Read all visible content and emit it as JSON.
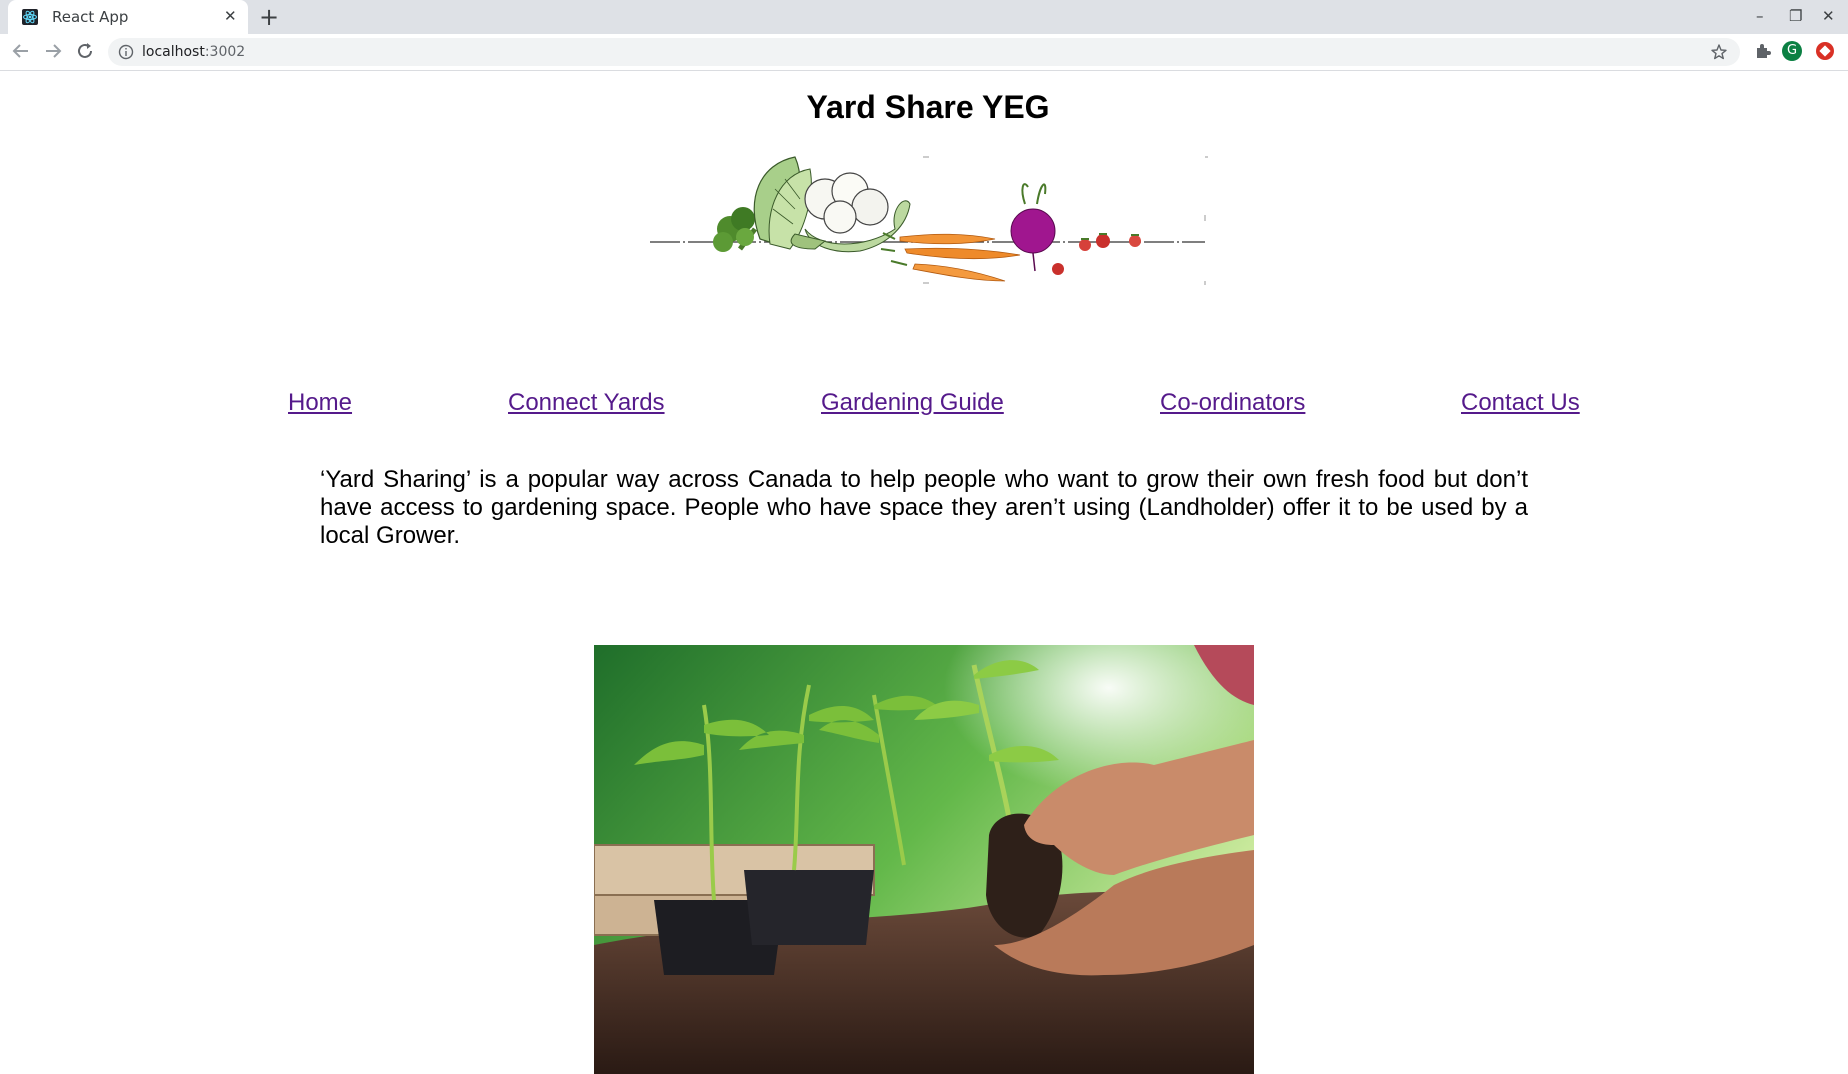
{
  "browser": {
    "tab_title": "React App",
    "tab_close_icon": "close-icon",
    "favicon": "react-atom-icon",
    "new_tab_icon": "plus-icon",
    "url_host": "localhost",
    "url_port": ":3002",
    "avatar_letter": "G",
    "window_controls": [
      "minimize-icon",
      "restore-icon",
      "close-icon"
    ],
    "accent_color": "#0b8043",
    "extension_red": "#d93025"
  },
  "page": {
    "title": "Yard Share YEG",
    "banner_image": "vegetables-sketch-banner",
    "nav": {
      "home": "Home",
      "connect_yards": "Connect Yards",
      "gardening_guide": "Gardening Guide",
      "coordinators": "Co-ordinators",
      "contact_us": "Contact Us"
    },
    "link_color": "#551a8b",
    "intro": "‘Yard Sharing’ is a popular way across Canada to help people who want to grow their own fresh food but don’t have access to gardening space. People who have space they aren’t using (Landholder) offer it to be used by a local Grower.",
    "photo": "hands-planting-tomato-seedlings-photo"
  }
}
